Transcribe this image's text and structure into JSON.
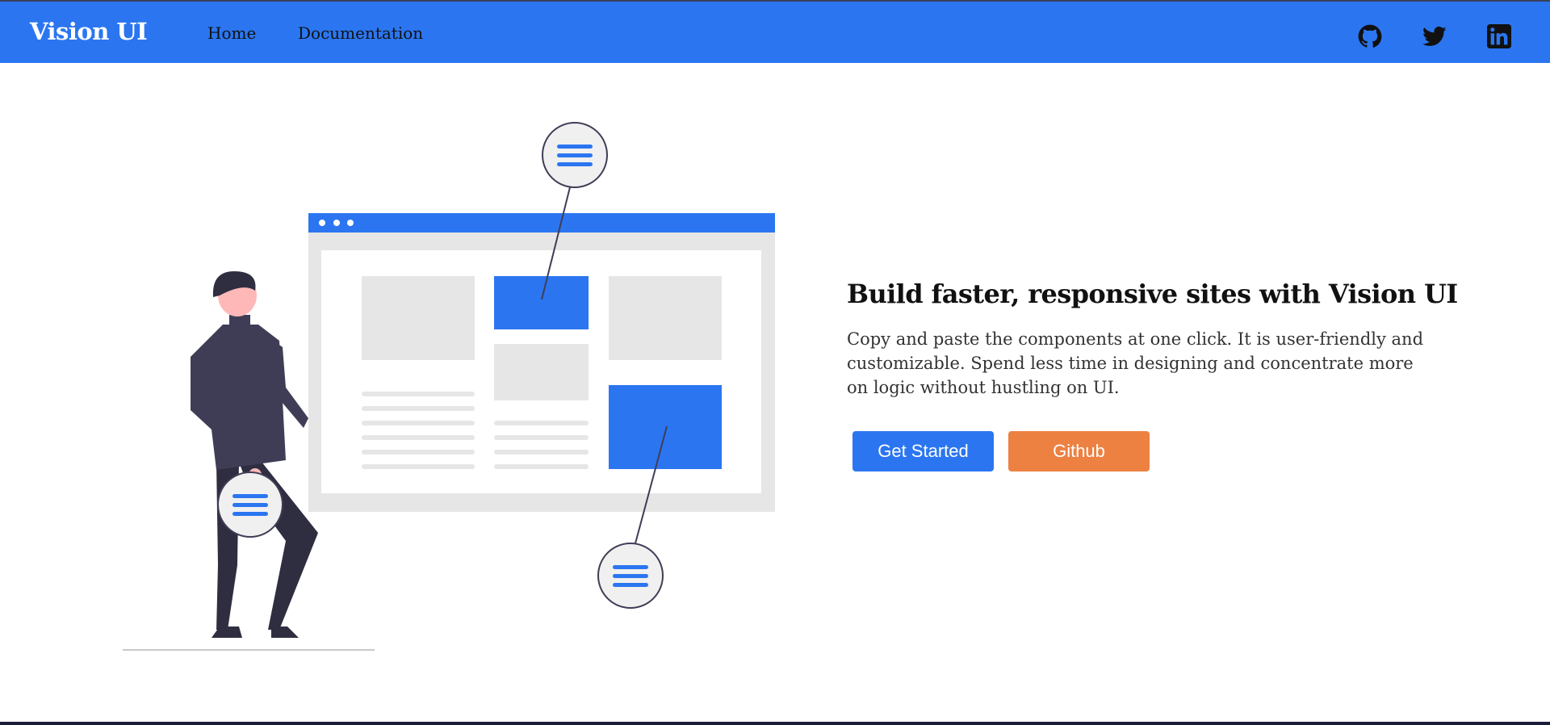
{
  "brand": "Vision UI",
  "nav": {
    "home": "Home",
    "documentation": "Documentation"
  },
  "social": [
    {
      "icon": "github-icon"
    },
    {
      "icon": "twitter-icon"
    },
    {
      "icon": "linkedin-icon"
    }
  ],
  "hero": {
    "title": "Build faster, responsive sites with Vision UI",
    "description": "Copy and paste the components at one click. It is user-friendly and customizable. Spend less time in designing and concentrate more on logic without hustling on UI.",
    "primary_button": "Get Started",
    "secondary_button": "Github"
  },
  "colors": {
    "accent": "#2b76f0",
    "secondary": "#ec8142",
    "illustration_gray": "#e6e6e6",
    "figure_dark": "#3f3d56"
  }
}
